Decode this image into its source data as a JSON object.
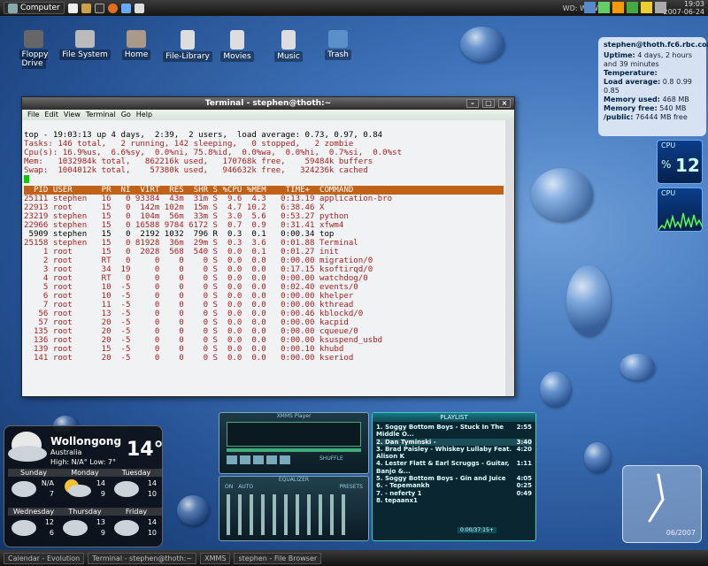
{
  "topbar": {
    "computer_label": "Computer",
    "workspace": "WD: WSW",
    "clock_time": "19:03",
    "clock_date": "2007-06-24"
  },
  "desktop": {
    "icons": [
      "Floppy Drive",
      "File System",
      "Home",
      "File-Library",
      "Movies",
      "Music",
      "Trash"
    ]
  },
  "sysmon": {
    "host": "stephen@thoth.fc6.rbc.com",
    "rows": [
      {
        "k": "Uptime:",
        "v": "4 days, 2 hours and 39 minutes"
      },
      {
        "k": "Temperature:",
        "v": ""
      },
      {
        "k": "Load average:",
        "v": "0.8 0.99 0.85"
      },
      {
        "k": "Memory used:",
        "v": "468 MB"
      },
      {
        "k": "Memory free:",
        "v": "540 MB"
      },
      {
        "k": "/public:",
        "v": "76444 MB free"
      }
    ]
  },
  "cpu_widgets": [
    {
      "label": "CPU",
      "value": "12",
      "unit": "%"
    },
    {
      "label": "CPU",
      "value": ""
    }
  ],
  "terminal": {
    "title": "Terminal - stephen@thoth:~",
    "menu": [
      "File",
      "Edit",
      "View",
      "Terminal",
      "Go",
      "Help"
    ],
    "summary": [
      "top - 19:03:13 up 4 days,  2:39,  2 users,  load average: 0.73, 0.97, 0.84",
      "Tasks: 146 total,   2 running, 142 sleeping,   0 stopped,   2 zombie",
      "Cpu(s): 16.9%us,  6.6%sy,  0.0%ni, 75.8%id,  0.0%wa,  0.0%hi,  0.7%si,  0.0%st",
      "Mem:   1032984k total,   862216k used,   170768k free,    59484k buffers",
      "Swap:  1004012k total,    57380k used,   946632k free,   324236k cached"
    ],
    "header": "  PID USER      PR  NI  VIRT  RES  SHR S %CPU %MEM    TIME+  COMMAND",
    "procs": [
      "25111 stephen   16   0 93384  43m  31m S  9.6  4.3   0:13.19 application-bro",
      "22913 root      15   0  142m 102m  15m S  4.7 10.2   6:38.46 X",
      "23219 stephen   15   0  104m  56m  33m S  3.0  5.6   0:53.27 python",
      "22966 stephen   15   0 16588 9784 6172 S  0.7  0.9   0:31.41 xfwm4",
      " 5909 stephen   15   0  2192 1032  796 R  0.3  0.1   0:00.34 top",
      "25158 stephen   15   0 81928  36m  29m S  0.3  3.6   0:01.88 Terminal",
      "    1 root      15   0  2028  568  540 S  0.0  0.1   0:01.27 init",
      "    2 root      RT   0     0    0    0 S  0.0  0.0   0:00.00 migration/0",
      "    3 root      34  19     0    0    0 S  0.0  0.0   0:17.15 ksoftirqd/0",
      "    4 root      RT   0     0    0    0 S  0.0  0.0   0:00.00 watchdog/0",
      "    5 root      10  -5     0    0    0 S  0.0  0.0   0:02.40 events/0",
      "    6 root      10  -5     0    0    0 S  0.0  0.0   0:00.00 khelper",
      "    7 root      11  -5     0    0    0 S  0.0  0.0   0:00.00 kthread",
      "   56 root      13  -5     0    0    0 S  0.0  0.0   0:00.46 kblockd/0",
      "   57 root      20  -5     0    0    0 S  0.0  0.0   0:00.00 kacpid",
      "  135 root      20  -5     0    0    0 S  0.0  0.0   0:00.00 cqueue/0",
      "  136 root      20  -5     0    0    0 S  0.0  0.0   0:00.00 ksuspend_usbd",
      "  139 root      15  -5     0    0    0 S  0.0  0.0   0:00.10 khubd",
      "  141 root      20  -5     0    0    0 S  0.0  0.0   0:00.00 kseriod"
    ]
  },
  "weather": {
    "city": "Wollongong",
    "country": "Australia",
    "hilow": "High: N/A°  Low: 7°",
    "temp": "14°",
    "days": [
      {
        "name": "Sunday",
        "hi": "N/A",
        "lo": "7"
      },
      {
        "name": "Monday",
        "hi": "14",
        "lo": "9"
      },
      {
        "name": "Tuesday",
        "hi": "14",
        "lo": "10"
      },
      {
        "name": "Wednesday",
        "hi": "12",
        "lo": "6"
      },
      {
        "name": "Thursday",
        "hi": "13",
        "lo": "9"
      },
      {
        "name": "Friday",
        "hi": "14",
        "lo": "10"
      }
    ]
  },
  "xmms": {
    "title": "XMMS Player",
    "eq_label": "EQUALIZER",
    "eq_on": "ON",
    "eq_auto": "AUTO",
    "eq_presets": "PRESETS",
    "shuffle": "SHUFFLE"
  },
  "playlist": {
    "title": "PLAYLIST",
    "total": "0:00/37:15+",
    "tracks": [
      {
        "t": "1. Soggy Bottom Boys - Stuck In The Middle O...",
        "d": "2:55"
      },
      {
        "t": "2. Dan Tyminski -",
        "d": "3:40"
      },
      {
        "t": "3. Brad Paisley - Whiskey Lullaby Feat. Alison K",
        "d": "4:20"
      },
      {
        "t": "4. Lester Flatt & Earl Scruggs - Guitar, Banjo &...",
        "d": "1:11"
      },
      {
        "t": "5. Soggy Bottom Boys - Gin and Juice",
        "d": "4:05"
      },
      {
        "t": "6. - Tepemankh",
        "d": "0:25"
      },
      {
        "t": "7. - neferty 1",
        "d": "0:49"
      },
      {
        "t": "8. tepaanx1",
        "d": ""
      }
    ]
  },
  "analog_clock": {
    "date": "06/2007"
  },
  "taskbar": {
    "items": [
      "Calendar - Evolution",
      "Terminal - stephen@thoth:~",
      "XMMS",
      "stephen - File Browser"
    ]
  }
}
